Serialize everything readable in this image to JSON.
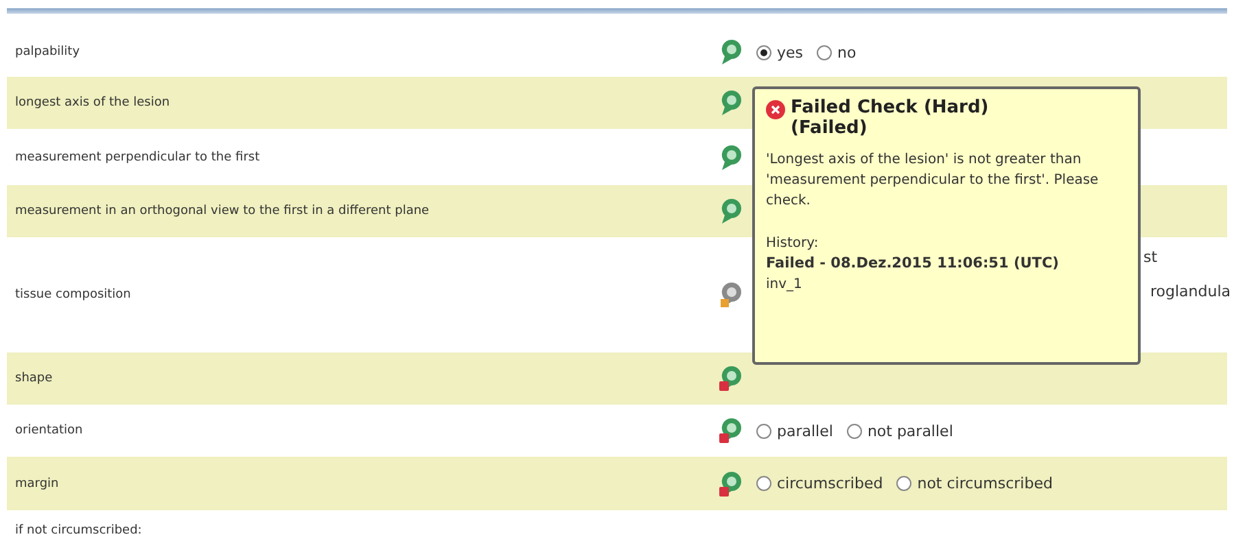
{
  "rows": [
    {
      "label": "palpability",
      "kind": "ok",
      "options": [
        {
          "label": "yes",
          "selected": true
        },
        {
          "label": "no",
          "selected": false
        }
      ]
    },
    {
      "label": "longest axis of the lesion",
      "kind": "ok"
    },
    {
      "label": "measurement perpendicular to the first",
      "kind": "ok"
    },
    {
      "label": "measurement in an orthogonal view to the first in a different plane",
      "kind": "ok"
    },
    {
      "label": "tissue composition",
      "kind": "pending",
      "fragments": [
        "st",
        "roglandula"
      ]
    },
    {
      "label": "shape",
      "kind": "error"
    },
    {
      "label": "orientation",
      "kind": "error",
      "options": [
        {
          "label": "parallel",
          "selected": false
        },
        {
          "label": "not parallel",
          "selected": false
        }
      ]
    },
    {
      "label": "margin",
      "kind": "error",
      "options": [
        {
          "label": "circumscribed",
          "selected": false
        },
        {
          "label": "not circumscribed",
          "selected": false
        }
      ]
    },
    {
      "label": "if not circumscribed:"
    }
  ],
  "tooltip": {
    "title": "Failed Check (Hard)",
    "subtitle": "(Failed)",
    "message": "'Longest axis of the lesion' is not greater than 'measurement perpendicular to the first'. Please check.",
    "history_label": "History:",
    "history_entry": "Failed - 08.Dez.2015 11:06:51 (UTC)",
    "user": "inv_1"
  }
}
